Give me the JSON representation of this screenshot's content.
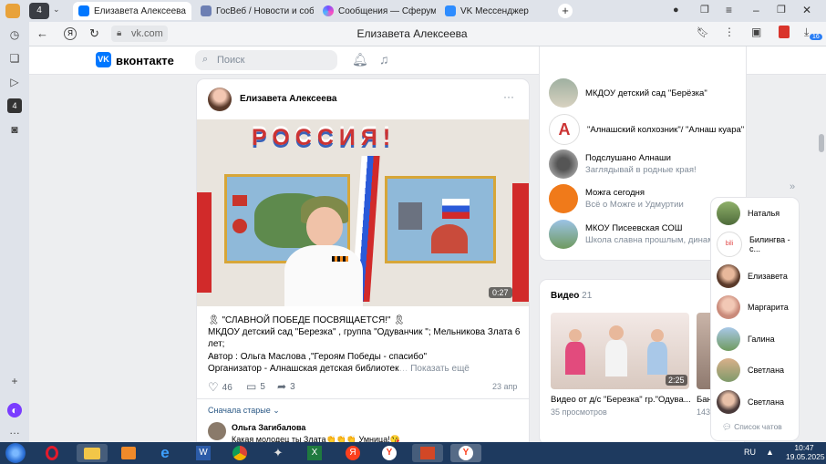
{
  "browser": {
    "tabs": [
      {
        "label": "Елизавета Алексеева",
        "active": true
      },
      {
        "label": "ГосВеб / Новости и собы",
        "active": false
      },
      {
        "label": "Сообщения — Сферум",
        "active": false
      },
      {
        "label": "VK Мессенджер",
        "active": false
      }
    ],
    "tab_counter": "4",
    "url": "vk.com",
    "page_title": "Елизавета Алексеева",
    "badge_count": "16"
  },
  "vk": {
    "logo_text": "вконтакте",
    "search_placeholder": "Поиск",
    "post": {
      "author": "Елизавета Алексеева",
      "video_banner": "РОССИЯ!",
      "video_duration": "0:27",
      "text_line1": "🎗 \"СЛАВНОЙ ПОБЕДЕ ПОСВЯЩАЕТСЯ!\" 🎗",
      "text_line2": "МКДОУ детский сад \"Березка\" , группа \"Одуванчик \"; Мельникова Злата 6",
      "text_line3": "лет;",
      "text_line4": "Автор : Ольга Маслова ,\"Героям Победы - спасибо\"",
      "text_line5": "Организатор - Алнашская детская библиотек",
      "show_more": "Показать ещё",
      "likes": "46",
      "comments": "5",
      "shares": "3",
      "date": "23 апр",
      "sort_label": "Сначала старые",
      "commenter": "Ольга Загибалова",
      "comment_snippet": "Какая молодец ты Злата👏👏👏 Умница!😘"
    },
    "groups": [
      {
        "name": "МКДОУ детский сад \"Берёзка\"",
        "sub": ""
      },
      {
        "name": "\"Алнашский колхозник\"/ \"Алнаш куара\"",
        "sub": ""
      },
      {
        "name": "Подслушано Алнаши",
        "sub": "Заглядывай в родные края!"
      },
      {
        "name": "Можга сегодня",
        "sub": "Всё о Можге и Удмуртии"
      },
      {
        "name": "МКОУ Писеевская СОШ",
        "sub": "Школа славна прошлым, динамикой"
      }
    ],
    "videos": {
      "title": "Видео",
      "count": "21",
      "items": [
        {
          "title": "Видео от д/с \"Березка\" гр.\"Одува...",
          "views": "35 просмотров",
          "duration": "2:25"
        },
        {
          "title": "Бан",
          "views": "143",
          "duration": ""
        }
      ]
    },
    "friends": [
      {
        "name": "Наталья"
      },
      {
        "name": "Билингва - с..."
      },
      {
        "name": "Елизавета"
      },
      {
        "name": "Маргарита"
      },
      {
        "name": "Галина"
      },
      {
        "name": "Светлана"
      },
      {
        "name": "Светлана"
      }
    ],
    "chat_list_label": "Список чатов"
  },
  "taskbar": {
    "lang": "RU",
    "time": "10:47",
    "date": "19.05.2025"
  }
}
